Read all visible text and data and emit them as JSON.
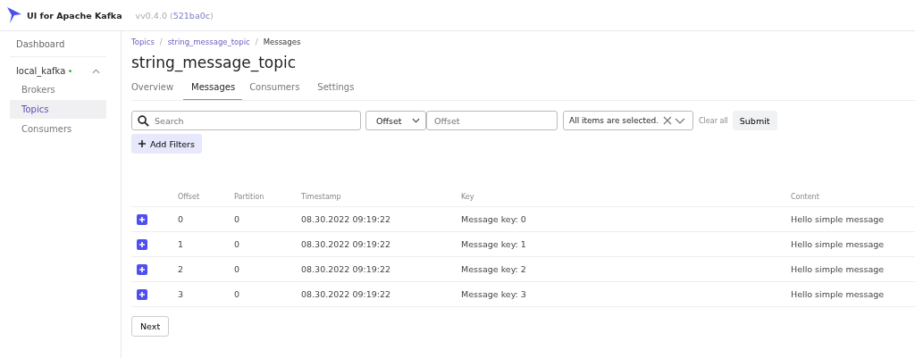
{
  "header": {
    "app_name": "UI for Apache Kafka",
    "version_prefix": "vv0.4.0 (",
    "commit": "521ba0c",
    "version_suffix": ")"
  },
  "sidebar": {
    "items": [
      {
        "label": "Dashboard",
        "kind": "top",
        "selected": false
      },
      {
        "label": "local_kafka",
        "kind": "cluster",
        "online": true,
        "expanded": true
      },
      {
        "label": "Brokers",
        "kind": "sub",
        "selected": false
      },
      {
        "label": "Topics",
        "kind": "sub",
        "selected": true
      },
      {
        "label": "Consumers",
        "kind": "sub",
        "selected": false
      }
    ]
  },
  "breadcrumbs": [
    {
      "label": "Topics",
      "link": true
    },
    {
      "separator": "/",
      "label": "string_message_topic",
      "link": true
    },
    {
      "separator": "/",
      "label": "Messages",
      "link": false
    }
  ],
  "title": "string_message_topic",
  "tabs": [
    {
      "label": "Overview",
      "selected": false
    },
    {
      "label": "Messages",
      "selected": true
    },
    {
      "label": "Consumers",
      "selected": false
    },
    {
      "label": "Settings",
      "selected": false
    }
  ],
  "filters": {
    "search": {
      "placeholder": "Search"
    },
    "seek_type": "Offset",
    "offset": {
      "placeholder": "Offset"
    },
    "partitions": "All items are selected.",
    "clear_all": "Clear all",
    "submit": "Submit",
    "add_filters": "Add Filters"
  },
  "table": {
    "columns": [
      "Offset",
      "Partition",
      "Timestamp",
      "Key",
      "Content"
    ],
    "rows": [
      {
        "expanded": false,
        "cells": [
          "0",
          "0",
          "08.30.2022 09:19:22",
          "Message key: 0",
          "Hello simple message"
        ]
      },
      {
        "expanded": false,
        "cells": [
          "1",
          "0",
          "08.30.2022 09:19:22",
          "Message key: 1",
          "Hello simple message"
        ]
      },
      {
        "expanded": false,
        "cells": [
          "2",
          "0",
          "08.30.2022 09:19:22",
          "Message key: 2",
          "Hello simple message"
        ]
      },
      {
        "expanded": false,
        "cells": [
          "3",
          "0",
          "08.30.2022 09:19:22",
          "Message key: 3",
          "Hello simple message"
        ]
      }
    ]
  },
  "next": "Next"
}
